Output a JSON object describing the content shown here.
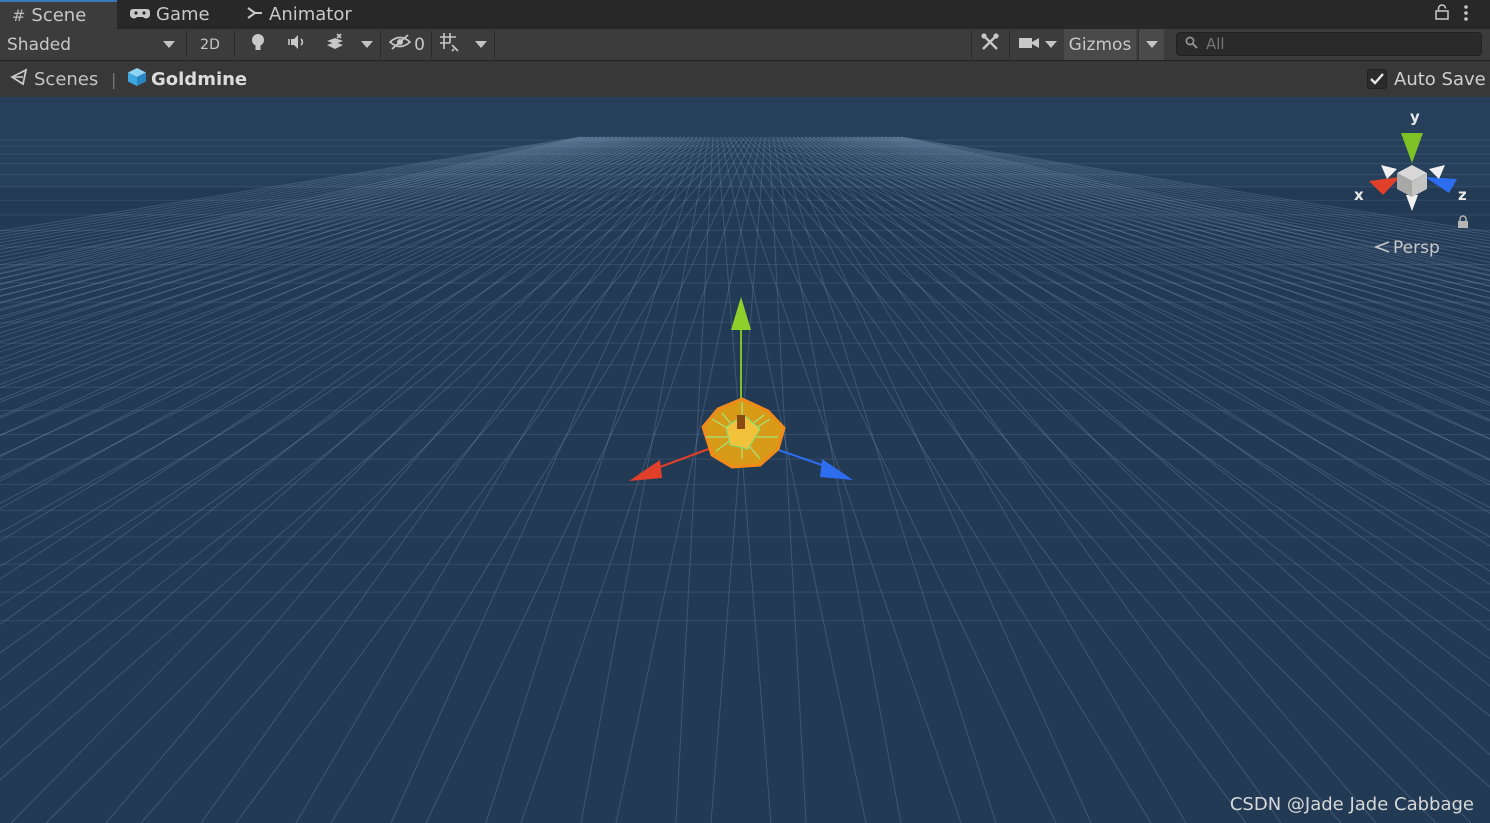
{
  "tabs": [
    {
      "label": "Scene",
      "icon": "hash-icon",
      "active": true
    },
    {
      "label": "Game",
      "icon": "gamepad-icon",
      "active": false
    },
    {
      "label": "Animator",
      "icon": "animator-icon",
      "active": false
    }
  ],
  "toolbar": {
    "draw_mode": "Shaded",
    "mode_2d": "2D",
    "hidden_count": "0",
    "gizmos_label": "Gizmos",
    "search_placeholder": "All"
  },
  "breadcrumb": {
    "scenes_label": "Scenes",
    "current_label": "Goldmine",
    "auto_save_label": "Auto Save",
    "auto_save_checked": true
  },
  "orientation_gizmo": {
    "y_label": "y",
    "x_label": "x",
    "z_label": "z",
    "projection_label": "Persp"
  },
  "colors": {
    "viewport_bg": "#233a55",
    "x_axis": "#e0402a",
    "y_axis": "#7ec226",
    "z_axis": "#2d6ef0",
    "selection": "#f5a623"
  },
  "watermark": "CSDN @Jade Jade Cabbage"
}
